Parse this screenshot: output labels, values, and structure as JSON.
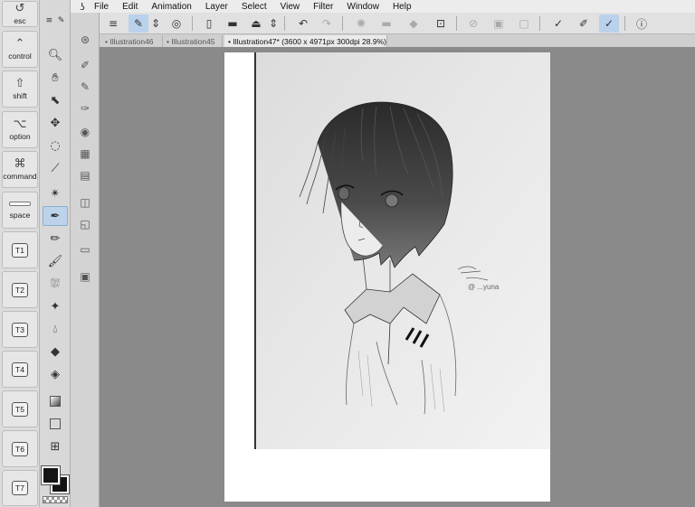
{
  "menu": {
    "items": [
      "File",
      "Edit",
      "Animation",
      "Layer",
      "Select",
      "View",
      "Filter",
      "Window",
      "Help"
    ]
  },
  "modifiers": {
    "esc": "esc",
    "control": "control",
    "shift": "shift",
    "option": "option",
    "command": "command",
    "space": "space",
    "t1": "T1",
    "t2": "T2",
    "t3": "T3",
    "t4": "T4",
    "t5": "T5",
    "t6": "T6",
    "t7": "T7"
  },
  "tabs": [
    {
      "label": "Illustration46"
    },
    {
      "label": "Illustration45"
    },
    {
      "label": "Illustration47* (3600 x 4971px 300dpi 28.9%)"
    }
  ],
  "colors": {
    "main_color": "#141414",
    "sub_color": "#141414",
    "accent": "#b9d1ea"
  },
  "signature": "@ ...yuna"
}
